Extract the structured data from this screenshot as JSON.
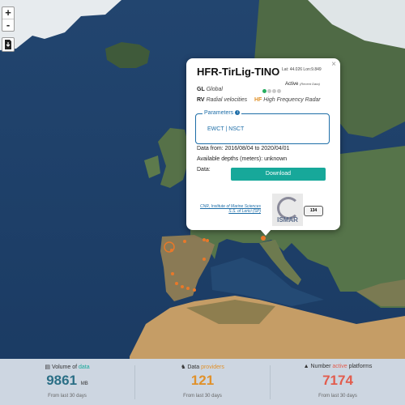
{
  "controls": {
    "zoom_in": "+",
    "zoom_out": "-"
  },
  "popup": {
    "title": "HFR-TirLig-TINO",
    "close": "×",
    "latlon": "Lat: 44.026 Lon:9.849",
    "gl_code": "GL",
    "gl_text": "Global",
    "status": "Active",
    "status_note": "(Recent Data)",
    "rv_code": "RV",
    "rv_text": "Radial velocities",
    "hf_code": "HF",
    "hf_text": "High Frequency Radar",
    "parameters_label": "Parameters",
    "parameters_value": "EWCT | NSCT",
    "data_from": "Data from: 2016/08/04 to 2020/04/01",
    "depths": "Available depths (meters): unknown",
    "data_label": "Data:",
    "download": "Download",
    "institution": "CNR, Institute of Marine Sciences S.S. of Lerici (SP)",
    "logo_text": "ISMAR",
    "badge": "134"
  },
  "stats": [
    {
      "label_pre": "Volume of ",
      "label_hl": "data",
      "value": "9861",
      "unit": "MB",
      "sub": "From last 30 days",
      "color": "#2b6f86"
    },
    {
      "label_pre": "Data ",
      "label_hl": "providers",
      "value": "121",
      "unit": "",
      "sub": "From last 30 days",
      "color": "#e0912a"
    },
    {
      "label_pre": "Number ",
      "label_hl": "active",
      "value": "7174",
      "label_post": " platforms",
      "unit": "",
      "sub": "From last 30 days",
      "color": "#e25c4d"
    }
  ],
  "colors": {
    "ocean": "#1f3f68",
    "download": "#17a89a",
    "platform_marker": "#e8782a"
  },
  "icons": [
    "plus-icon",
    "minus-icon",
    "download-file-icon",
    "info-icon",
    "database-icon",
    "providers-icon",
    "platform-icon"
  ]
}
